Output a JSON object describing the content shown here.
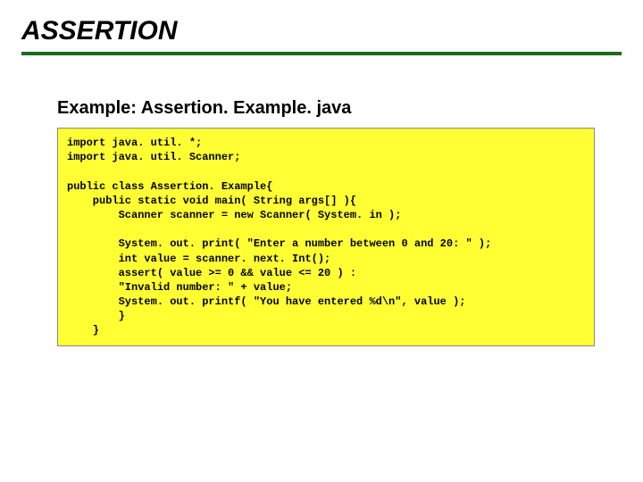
{
  "title": "ASSERTION",
  "exampleHeading": "Example: Assertion. Example. java",
  "code": "import java. util. *;\nimport java. util. Scanner;\n\npublic class Assertion. Example{\n    public static void main( String args[] ){\n        Scanner scanner = new Scanner( System. in );\n\n        System. out. print( \"Enter a number between 0 and 20: \" );\n        int value = scanner. next. Int();\n        assert( value >= 0 && value <= 20 ) :\n        \"Invalid number: \" + value;\n        System. out. printf( \"You have entered %d\\n\", value );\n        }\n    }"
}
